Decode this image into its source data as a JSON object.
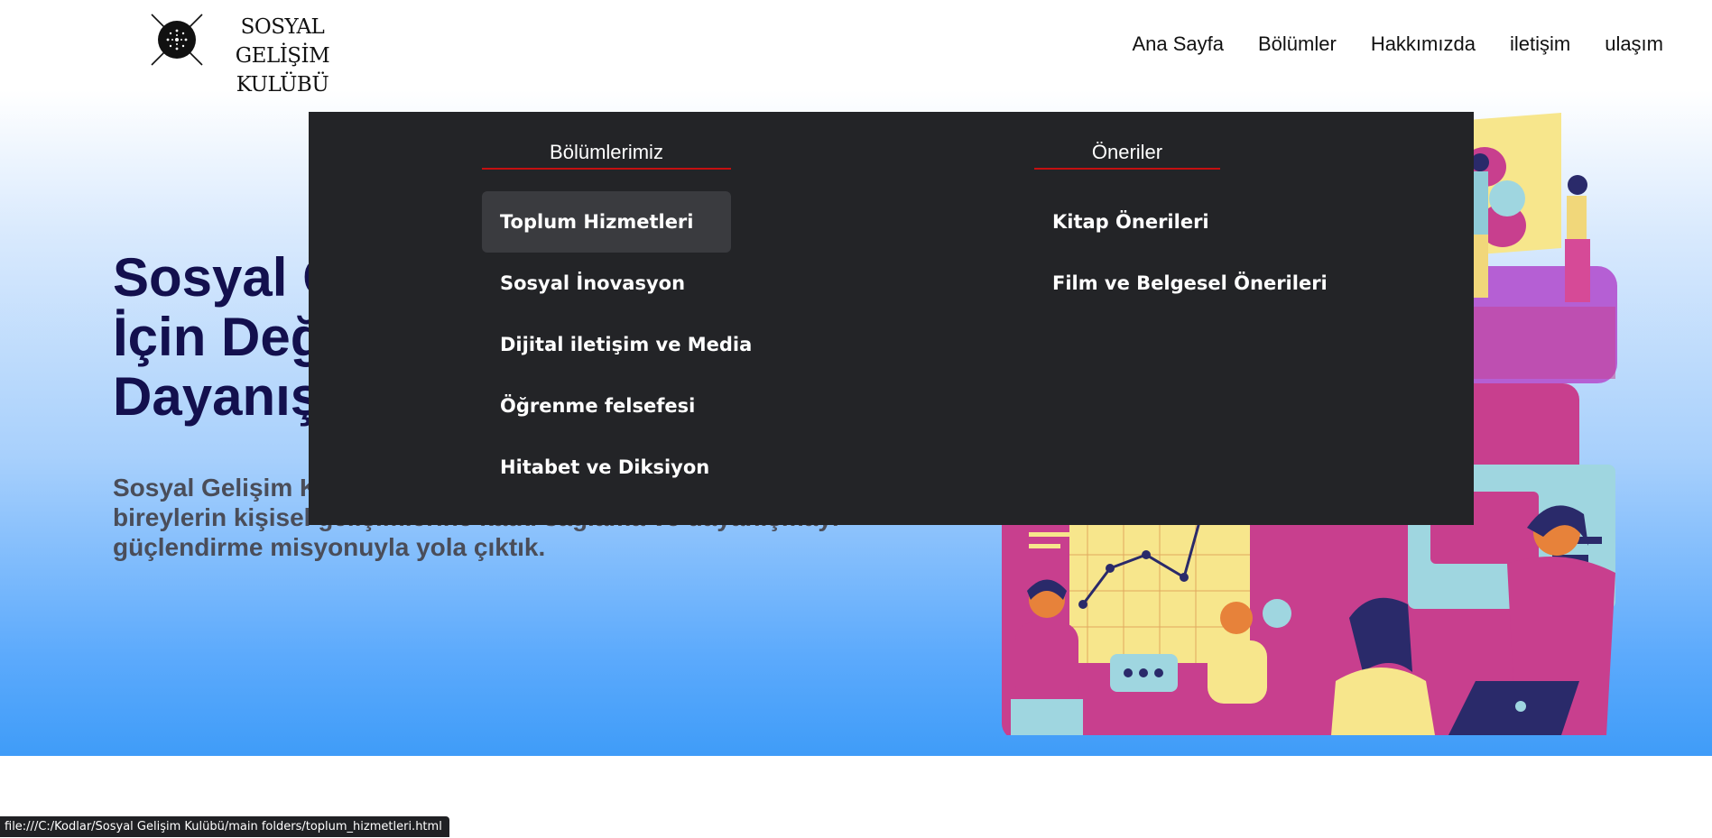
{
  "header": {
    "logo": {
      "line1": "SOSYAL GELİŞİM",
      "line2": "KULÜBÜ"
    },
    "nav": [
      {
        "label": "Ana Sayfa"
      },
      {
        "label": "Bölümler"
      },
      {
        "label": "Hakkımızda"
      },
      {
        "label": "iletişim"
      },
      {
        "label": "ulaşım"
      }
    ]
  },
  "hero": {
    "title_lines": [
      "Sosyal Gelişim ve Dönüşüm",
      "İçin Değişimin Odağında",
      "Dayanışma"
    ],
    "description_lines": [
      "Sosyal Gelişim Kulübü olarak, toplumda",
      "bireylerin kişisel gelişimlerine katkı sağlama ve dayanışmayı",
      "güçlendirme misyonuyla yola çıktık."
    ]
  },
  "dropdown": {
    "sections": [
      {
        "heading": "Bölümlerimiz",
        "items": [
          {
            "label": "Toplum Hizmetleri",
            "active": true
          },
          {
            "label": "Sosyal İnovasyon"
          },
          {
            "label": "Dijital iletişim ve Media"
          },
          {
            "label": "Öğrenme felsefesi"
          },
          {
            "label": "Hitabet ve Diksiyon"
          }
        ]
      },
      {
        "heading": "Öneriler",
        "items": [
          {
            "label": "Kitap Önerileri"
          },
          {
            "label": "Film ve Belgesel Önerileri"
          }
        ]
      }
    ]
  },
  "statusbar": {
    "url": "file:///C:/Kodlar/Sosyal Gelişim Kulübü/main folders/toplum_hizmetleri.html"
  },
  "colors": {
    "title": "#13104e",
    "dropdown_bg": "#232427",
    "heading_underline": "#c41010",
    "hero_gradient_bottom": "#3f9cf8"
  }
}
